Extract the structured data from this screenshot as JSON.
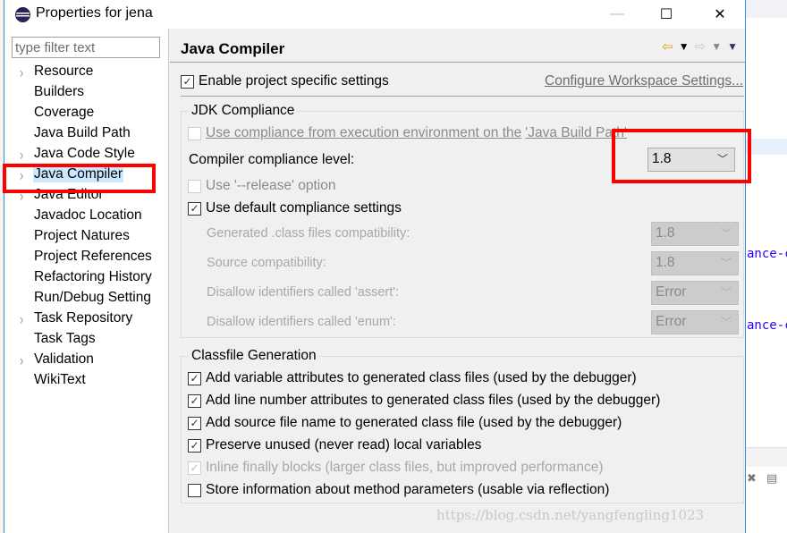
{
  "window": {
    "title": "Properties for jena",
    "controls": {
      "minimize": "—",
      "maximize": "☐",
      "close": "✕"
    }
  },
  "sidebar": {
    "filter_placeholder": "type filter text",
    "items": [
      {
        "label": "Resource",
        "expandable": true,
        "selected": false
      },
      {
        "label": "Builders",
        "expandable": false,
        "selected": false
      },
      {
        "label": "Coverage",
        "expandable": false,
        "selected": false
      },
      {
        "label": "Java Build Path",
        "expandable": false,
        "selected": false
      },
      {
        "label": "Java Code Style",
        "expandable": true,
        "selected": false
      },
      {
        "label": "Java Compiler",
        "expandable": true,
        "selected": true
      },
      {
        "label": "Java Editor",
        "expandable": true,
        "selected": false
      },
      {
        "label": "Javadoc Location",
        "expandable": false,
        "selected": false
      },
      {
        "label": "Project Natures",
        "expandable": false,
        "selected": false
      },
      {
        "label": "Project References",
        "expandable": false,
        "selected": false
      },
      {
        "label": "Refactoring History",
        "expandable": false,
        "selected": false
      },
      {
        "label": "Run/Debug Setting",
        "expandable": false,
        "selected": false
      },
      {
        "label": "Task Repository",
        "expandable": true,
        "selected": false
      },
      {
        "label": "Task Tags",
        "expandable": false,
        "selected": false
      },
      {
        "label": "Validation",
        "expandable": true,
        "selected": false
      },
      {
        "label": "WikiText",
        "expandable": false,
        "selected": false
      }
    ]
  },
  "page": {
    "title": "Java Compiler",
    "nav": {
      "back": "⇦",
      "back_menu": "▼",
      "forward": "⇨",
      "forward_menu": "▼",
      "view_menu": "▼"
    },
    "enable_project_specific": {
      "label": "Enable project specific settings",
      "checked": true
    },
    "configure_link": "Configure Workspace Settings...",
    "jdk_compliance": {
      "title": "JDK Compliance",
      "use_ee_compliance": {
        "label_prefix": "Use compliance from execution environment on the ",
        "link": "'Java Build Path'",
        "checked": false,
        "enabled": false
      },
      "compliance_level": {
        "label": "Compiler compliance level:",
        "value": "1.8"
      },
      "use_release": {
        "label": "Use '--release' option",
        "checked": false,
        "enabled": false
      },
      "use_default": {
        "label": "Use default compliance settings",
        "checked": true
      },
      "settings": [
        {
          "label": "Generated .class files compatibility:",
          "value": "1.8"
        },
        {
          "label": "Source compatibility:",
          "value": "1.8"
        },
        {
          "label": "Disallow identifiers called 'assert':",
          "value": "Error"
        },
        {
          "label": "Disallow identifiers called 'enum':",
          "value": "Error"
        }
      ]
    },
    "classfile_generation": {
      "title": "Classfile Generation",
      "options": [
        {
          "label": "Add variable attributes to generated class files (used by the debugger)",
          "checked": true,
          "enabled": true
        },
        {
          "label": "Add line number attributes to generated class files (used by the debugger)",
          "checked": true,
          "enabled": true
        },
        {
          "label": "Add source file name to generated class file (used by the debugger)",
          "checked": true,
          "enabled": true
        },
        {
          "label": "Preserve unused (never read) local variables",
          "checked": true,
          "enabled": true
        },
        {
          "label": "Inline finally blocks (larger class files, but improved performance)",
          "checked": true,
          "enabled": false
        },
        {
          "label": "Store information about method parameters (usable via reflection)",
          "checked": false,
          "enabled": true
        }
      ]
    }
  },
  "background": {
    "code_fragments": [
      "ance-c",
      "ance-c"
    ],
    "watermark": "https://blog.csdn.net/yangfengling1023"
  },
  "annotation_color": "#ff0000"
}
